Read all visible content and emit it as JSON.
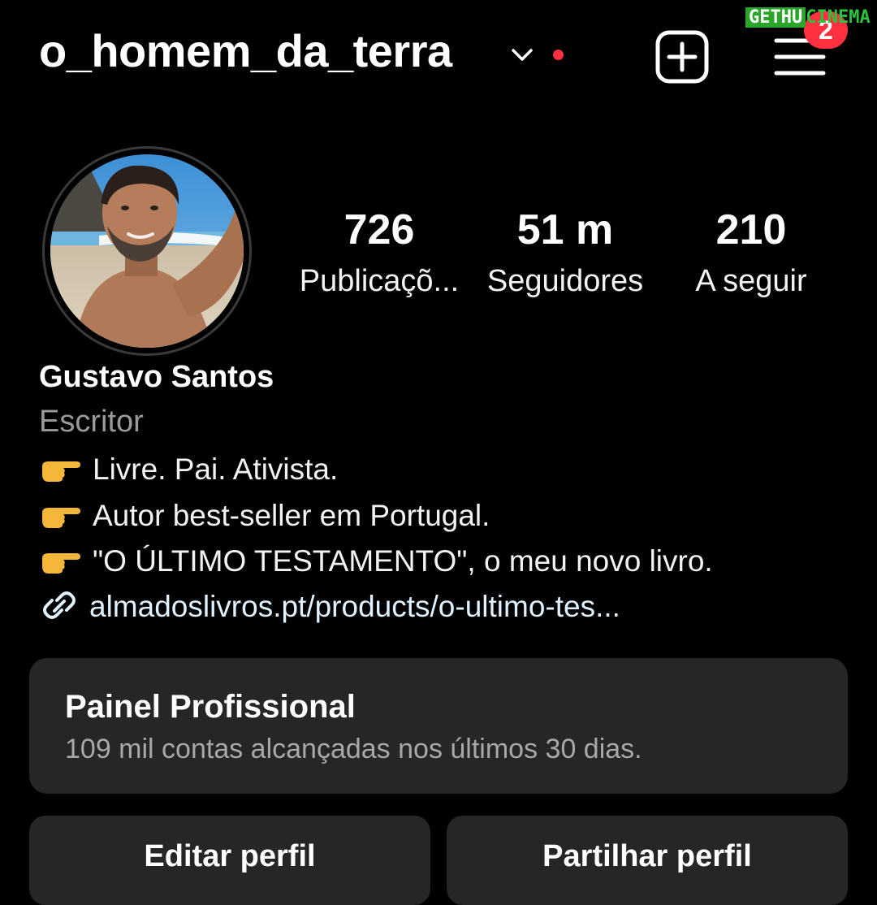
{
  "header": {
    "username": "o_homem_da_terra",
    "notification_count": "2",
    "watermark_left": "GETHU",
    "watermark_right": "CINEMA"
  },
  "stats": [
    {
      "value": "726",
      "label": "Publicaçõ..."
    },
    {
      "value": "51 m",
      "label": "Seguidores"
    },
    {
      "value": "210",
      "label": "A seguir"
    }
  ],
  "profile": {
    "name": "Gustavo Santos",
    "category": "Escritor",
    "bio": [
      "Livre. Pai. Ativista.",
      "Autor best-seller em Portugal.",
      "\"O ÚLTIMO TESTAMENTO\", o meu novo livro."
    ],
    "link": "almadoslivros.pt/products/o-ultimo-tes..."
  },
  "dashboard": {
    "title": "Painel Profissional",
    "subtitle": "109 mil contas alcançadas nos últimos 30 dias."
  },
  "actions": {
    "edit_profile": "Editar perfil",
    "share_profile": "Partilhar perfil"
  },
  "icons": {
    "account_switch": "chevron-down-icon",
    "create": "add-square-icon",
    "menu": "hamburger-menu-icon",
    "link": "link-icon",
    "bio_bullet": "pointing-hand-emoji"
  },
  "colors": {
    "background": "#000000",
    "surface": "#262626",
    "notification": "#ff3040",
    "link_text": "#e0f1ff",
    "muted_text": "#a8a8a8"
  }
}
